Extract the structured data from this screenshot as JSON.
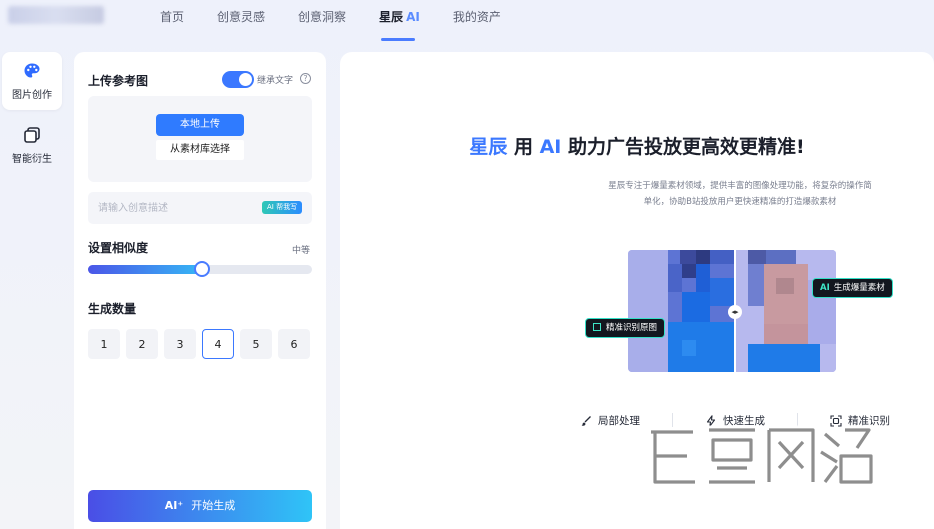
{
  "nav": {
    "items": [
      {
        "label": "首页",
        "active": false
      },
      {
        "label": "创意灵感",
        "active": false
      },
      {
        "label": "创意洞察",
        "active": false
      },
      {
        "label": "星辰",
        "accent": "AI",
        "active": true
      },
      {
        "label": "我的资产",
        "active": false
      }
    ]
  },
  "rail": {
    "items": [
      {
        "label": "图片创作",
        "icon": "palette-icon",
        "active": true
      },
      {
        "label": "智能衍生",
        "icon": "layers-icon",
        "active": false
      }
    ]
  },
  "panel": {
    "upload_title": "上传参考图",
    "toggle_label": "继承文字",
    "toggle_on": true,
    "help_glyph": "?",
    "upload_button": "本地上传",
    "library_button": "从素材库选择",
    "prompt_placeholder": "请输入创意描述",
    "ai_write_badge": "AI 帮我写",
    "similarity_title": "设置相似度",
    "similarity_value": "中等",
    "similarity_level": 0.51,
    "count_title": "生成数量",
    "count_options": [
      "1",
      "2",
      "3",
      "4",
      "5",
      "6"
    ],
    "count_selected": "4",
    "generate_ai": "AI⁺",
    "generate_label": "开始生成"
  },
  "hero": {
    "title_accent1": "星辰",
    "title_part2": "用",
    "title_accent2": "AI",
    "title_part3": "助力广告投放更高效更精准!",
    "subtitle_line1": "星辰专注于爆量素材领域，提供丰富的图像处理功能，将复杂的操作简",
    "subtitle_line2": "单化，协助B站投放用户更快速精准的打造爆款素材",
    "tag_generate_ai": "AI",
    "tag_generate": "生成爆量素材",
    "tag_recognize": "精准识别原图",
    "features": [
      {
        "label": "局部处理",
        "icon": "brush-icon"
      },
      {
        "label": "快速生成",
        "icon": "lightning-icon"
      },
      {
        "label": "精准识别",
        "icon": "scan-icon"
      }
    ]
  },
  "colors": {
    "accent": "#3b78ff",
    "tag_border": "#34e0c8",
    "gradient_start": "#4a4ee6",
    "gradient_end": "#2fc4f7"
  }
}
